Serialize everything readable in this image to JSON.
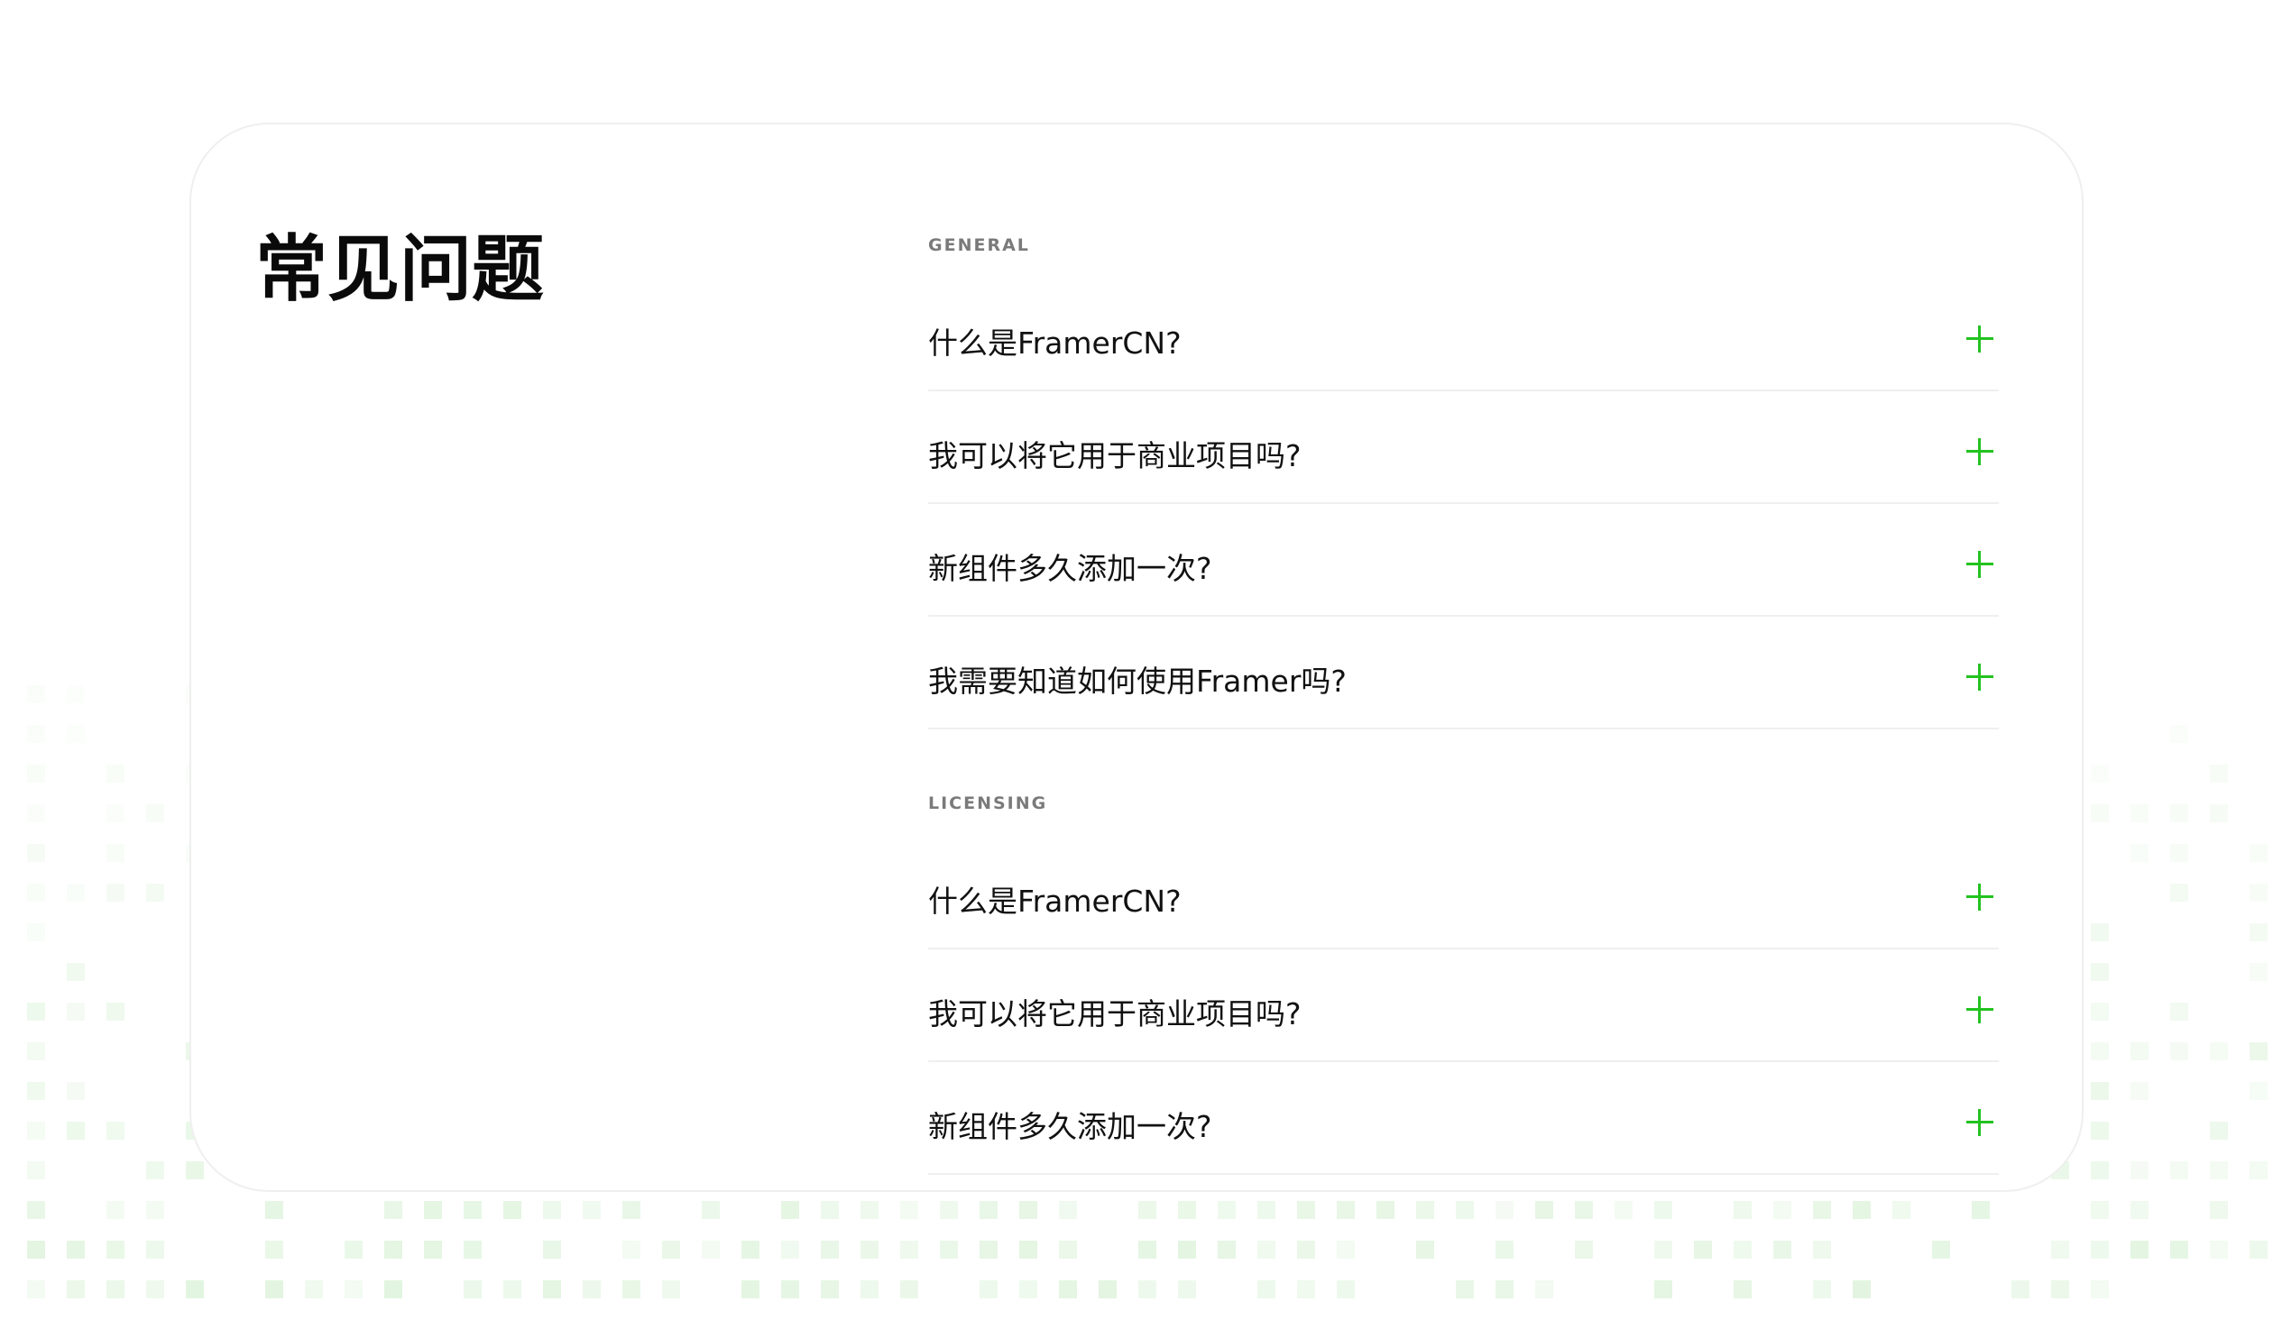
{
  "faq": {
    "title": "常见问题",
    "sections": [
      {
        "label": "GENERAL",
        "items": [
          {
            "question": "什么是FramerCN?"
          },
          {
            "question": "我可以将它用于商业项目吗?"
          },
          {
            "question": "新组件多久添加一次?"
          },
          {
            "question": "我需要知道如何使用Framer吗?"
          }
        ]
      },
      {
        "label": "LICENSING",
        "items": [
          {
            "question": "什么是FramerCN?"
          },
          {
            "question": "我可以将它用于商业项目吗?"
          },
          {
            "question": "新组件多久添加一次?"
          }
        ]
      }
    ],
    "icon": "plus-icon"
  },
  "colors": {
    "accent": "#22c31f",
    "divider": "#efefef",
    "section_label": "#7a7a7a",
    "background_pattern": "#d4f0d1"
  }
}
